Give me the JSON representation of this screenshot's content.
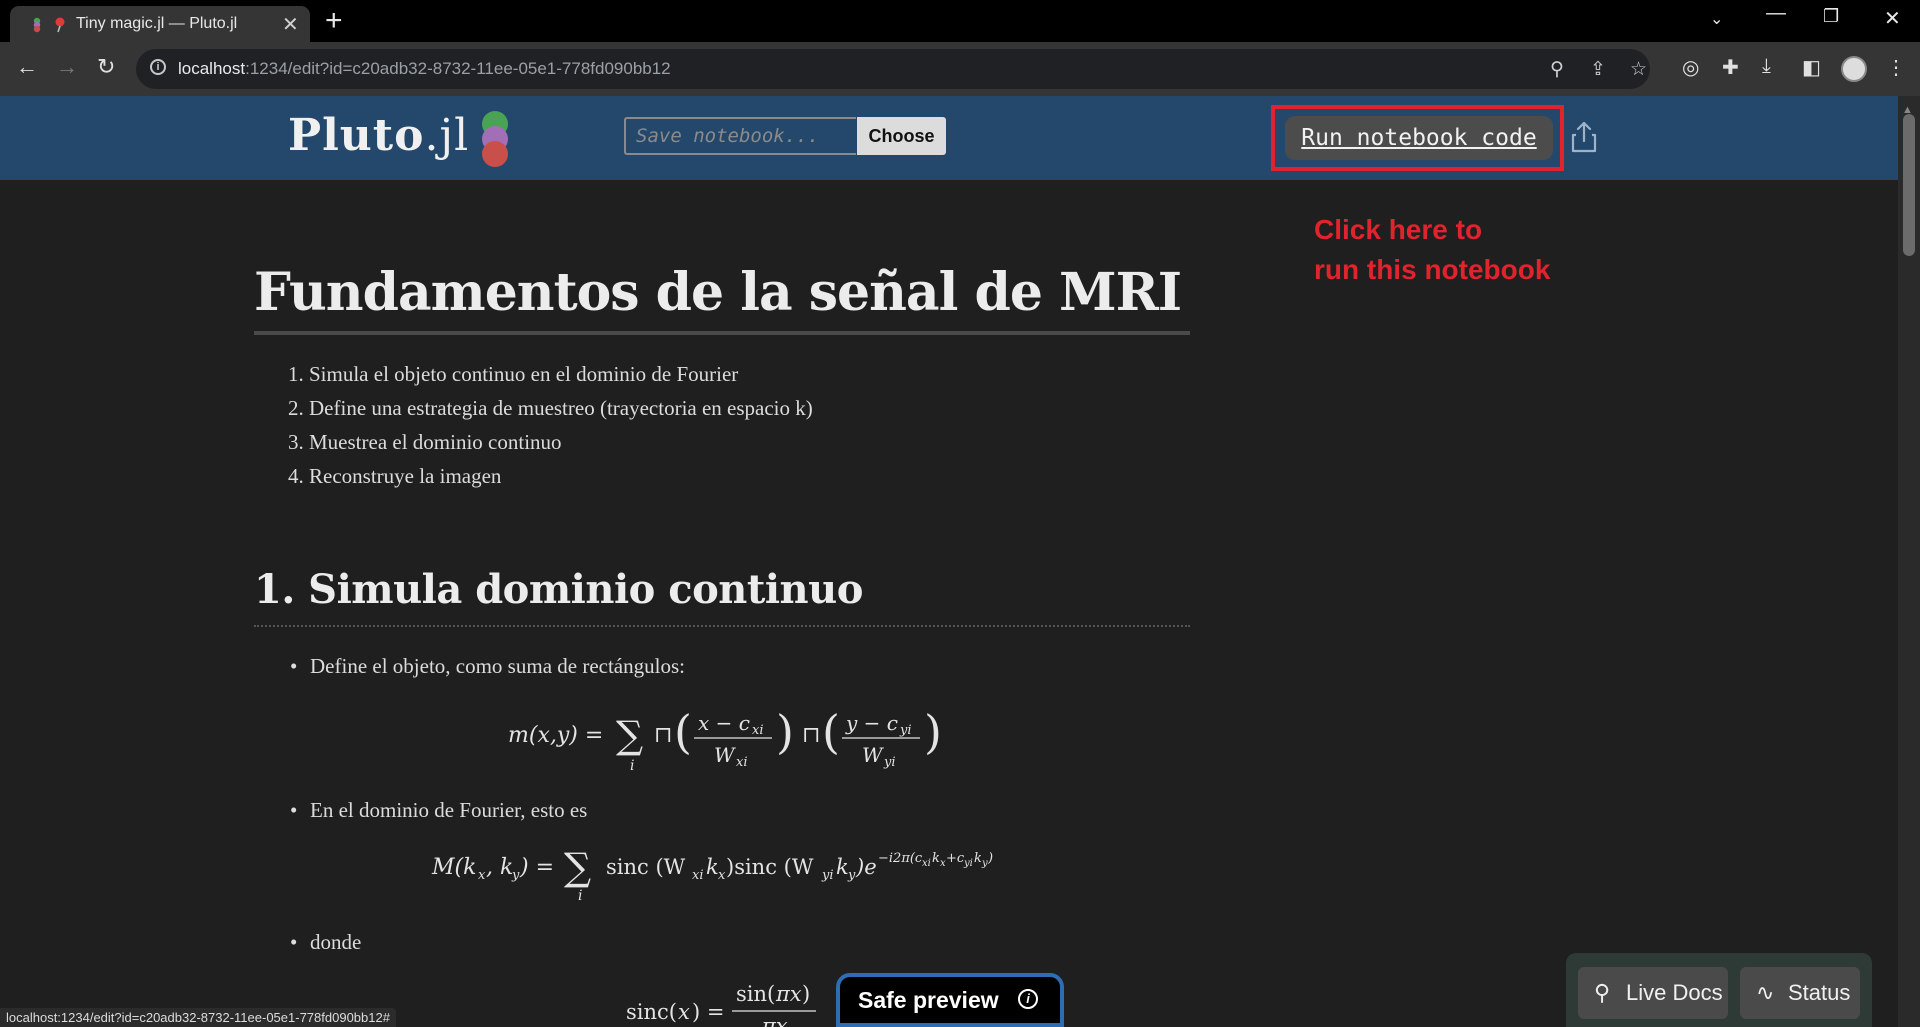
{
  "browser": {
    "tab_title": "Tiny magic.jl — Pluto.jl",
    "url_host": "localhost",
    "url_rest": ":1234/edit?id=c20adb32-8732-11ee-05e1-778fd090bb12",
    "status_url": "localhost:1234/edit?id=c20adb32-8732-11ee-05e1-778fd090bb12#"
  },
  "pluto": {
    "logo_main": "Pluto",
    "logo_ext": ".jl",
    "save_placeholder": "Save notebook...",
    "choose_label": "Choose",
    "run_label": "Run notebook code",
    "annotation_line1": "Click here to",
    "annotation_line2": "run this notebook"
  },
  "notebook": {
    "title": "Fundamentos de la señal de MRI",
    "steps": [
      "1. Simula el objeto continuo en el dominio de Fourier",
      "2. Define una estrategia de muestreo (trayectoria en espacio k)",
      "3. Muestrea el dominio continuo",
      "4. Reconstruye la imagen"
    ],
    "section1_title": "1. Simula dominio continuo",
    "bullet1": "Define el objeto, como suma de rectángulos:",
    "bullet2": "En el dominio de Fourier, esto es",
    "bullet3": "donde"
  },
  "footer": {
    "safe_preview": "Safe preview",
    "live_docs": "Live Docs",
    "status": "Status"
  },
  "colors": {
    "pluto_header": "#23486c",
    "annotation_red": "#e0232c",
    "notebook_bg": "#1f1f1f"
  }
}
